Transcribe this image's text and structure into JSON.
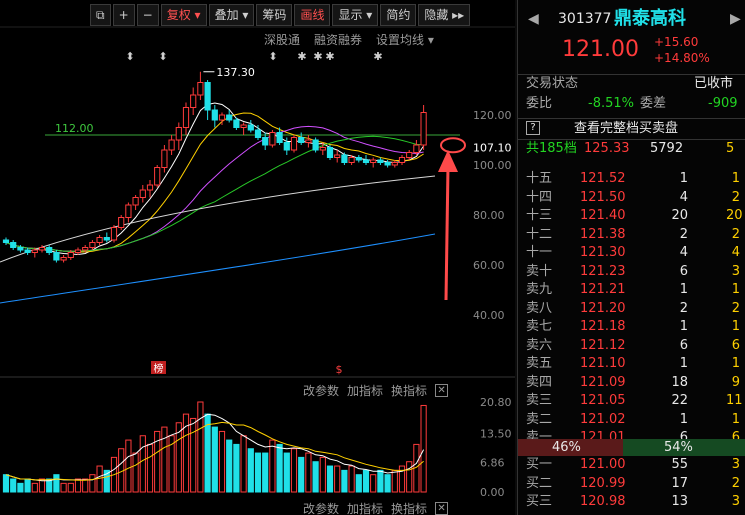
{
  "toolbar": {
    "items": [
      "复权",
      "叠加",
      "筹码",
      "画线",
      "显示",
      "简约",
      "隐藏"
    ],
    "icons": [
      "window-icon",
      "plus-icon",
      "minus-icon",
      "dropdown-icon",
      "double-arrow-icon"
    ]
  },
  "chart_tools": [
    "深股通",
    "融资融券",
    "设置均线"
  ],
  "indicator_tools": [
    "改参数",
    "加指标",
    "换指标"
  ],
  "annotations": {
    "high_label": "137.30",
    "hline_label": "112.00",
    "badge": "榜",
    "s_marker": "$",
    "arrow_color": "#ff4a4a"
  },
  "price_axis": [
    "120.00",
    "107.10",
    "100.00",
    "80.00",
    "60.00",
    "40.00"
  ],
  "volume_axis": [
    "20.80",
    "13.50",
    "6.86",
    "0.00"
  ],
  "quote": {
    "code": "301377",
    "name": "鼎泰高科",
    "price": "121.00",
    "change": "+15.60",
    "change_pct": "+14.80%",
    "status_label": "交易状态",
    "status_value": "已收市",
    "weibi_label": "委比",
    "weibi_value": "-8.51%",
    "weicha_label": "委差",
    "weicha_value": "-909",
    "full_book": "查看完整档买卖盘",
    "total_levels_label": "共185档",
    "total_price": "125.33",
    "total_vol": "5792",
    "total_count": "5",
    "sell_pct": "46%",
    "buy_pct": "54%"
  },
  "asks": [
    {
      "label": "十五",
      "price": "121.52",
      "vol": "1",
      "n": "1"
    },
    {
      "label": "十四",
      "price": "121.50",
      "vol": "4",
      "n": "2"
    },
    {
      "label": "十三",
      "price": "121.40",
      "vol": "20",
      "n": "20"
    },
    {
      "label": "十二",
      "price": "121.38",
      "vol": "2",
      "n": "2"
    },
    {
      "label": "十一",
      "price": "121.30",
      "vol": "4",
      "n": "4"
    },
    {
      "label": "卖十",
      "price": "121.23",
      "vol": "6",
      "n": "3"
    },
    {
      "label": "卖九",
      "price": "121.21",
      "vol": "1",
      "n": "1"
    },
    {
      "label": "卖八",
      "price": "121.20",
      "vol": "2",
      "n": "2"
    },
    {
      "label": "卖七",
      "price": "121.18",
      "vol": "1",
      "n": "1"
    },
    {
      "label": "卖六",
      "price": "121.12",
      "vol": "6",
      "n": "6"
    },
    {
      "label": "卖五",
      "price": "121.10",
      "vol": "1",
      "n": "1"
    },
    {
      "label": "卖四",
      "price": "121.09",
      "vol": "18",
      "n": "9"
    },
    {
      "label": "卖三",
      "price": "121.05",
      "vol": "22",
      "n": "11"
    },
    {
      "label": "卖二",
      "price": "121.02",
      "vol": "1",
      "n": "1"
    },
    {
      "label": "卖一",
      "price": "121.01",
      "vol": "6",
      "n": "6"
    }
  ],
  "bids": [
    {
      "label": "买一",
      "price": "121.00",
      "vol": "55",
      "n": "3"
    },
    {
      "label": "买二",
      "price": "120.99",
      "vol": "17",
      "n": "2"
    },
    {
      "label": "买三",
      "price": "120.98",
      "vol": "13",
      "n": "3"
    }
  ],
  "chart_data": {
    "type": "candlestick",
    "ylim": [
      35,
      140
    ],
    "ohlc": [
      [
        70,
        71,
        68,
        69
      ],
      [
        69,
        70,
        66,
        67
      ],
      [
        67,
        68,
        65,
        66
      ],
      [
        66,
        67,
        64,
        65
      ],
      [
        65,
        67,
        63,
        66
      ],
      [
        66,
        68,
        65,
        67
      ],
      [
        67,
        68,
        64,
        65
      ],
      [
        65,
        66,
        61,
        62
      ],
      [
        62,
        64,
        61,
        63
      ],
      [
        63,
        66,
        62,
        65
      ],
      [
        65,
        67,
        64,
        66
      ],
      [
        66,
        68,
        65,
        67
      ],
      [
        67,
        70,
        66,
        69
      ],
      [
        69,
        72,
        68,
        71
      ],
      [
        71,
        73,
        69,
        70
      ],
      [
        70,
        76,
        69,
        75
      ],
      [
        75,
        80,
        74,
        79
      ],
      [
        79,
        85,
        77,
        84
      ],
      [
        84,
        88,
        82,
        87
      ],
      [
        87,
        92,
        85,
        90
      ],
      [
        90,
        94,
        87,
        92
      ],
      [
        92,
        100,
        91,
        99
      ],
      [
        99,
        108,
        97,
        106
      ],
      [
        106,
        112,
        104,
        110
      ],
      [
        110,
        117,
        106,
        115
      ],
      [
        115,
        125,
        112,
        123
      ],
      [
        123,
        131,
        120,
        128
      ],
      [
        128,
        137.3,
        126,
        133
      ],
      [
        133,
        134,
        118,
        122
      ],
      [
        122,
        124,
        115,
        118
      ],
      [
        118,
        121,
        116,
        120
      ],
      [
        120,
        122,
        117,
        118
      ],
      [
        118,
        119,
        114,
        115
      ],
      [
        115,
        117,
        112,
        116
      ],
      [
        116,
        118,
        113,
        114
      ],
      [
        114,
        116,
        110,
        111
      ],
      [
        111,
        113,
        106,
        108
      ],
      [
        108,
        114,
        107,
        113
      ],
      [
        113,
        115,
        108,
        109
      ],
      [
        109,
        111,
        104,
        106
      ],
      [
        106,
        112,
        105,
        111
      ],
      [
        111,
        113,
        108,
        109
      ],
      [
        109,
        112,
        107,
        110
      ],
      [
        110,
        111,
        105,
        106
      ],
      [
        106,
        109,
        104,
        107
      ],
      [
        107,
        108,
        102,
        103
      ],
      [
        103,
        106,
        101,
        104
      ],
      [
        104,
        105,
        100,
        101
      ],
      [
        101,
        104,
        100,
        103
      ],
      [
        103,
        104,
        101,
        102
      ],
      [
        102,
        104,
        100,
        101
      ],
      [
        101,
        103,
        99,
        102
      ],
      [
        102,
        103,
        100,
        101
      ],
      [
        101,
        102,
        99,
        100
      ],
      [
        100,
        102,
        99,
        101
      ],
      [
        101,
        104,
        100,
        103
      ],
      [
        103,
        106,
        102,
        105
      ],
      [
        105,
        110,
        104,
        108
      ],
      [
        108,
        124,
        106,
        121
      ]
    ],
    "volume": [
      4,
      3,
      2,
      3,
      2,
      3,
      3,
      4,
      2,
      2,
      3,
      3,
      4,
      6,
      5,
      8,
      10,
      12,
      9,
      13,
      11,
      14,
      15,
      13,
      16,
      18,
      17,
      20.8,
      18,
      15,
      14,
      12,
      11,
      13,
      10,
      9,
      9,
      12,
      11,
      9,
      10,
      8,
      9,
      7,
      8,
      6,
      6,
      5,
      6,
      4,
      5,
      4,
      5,
      4,
      5,
      6,
      7,
      11,
      20
    ],
    "hline": 112.0,
    "current_price": 107.1
  }
}
